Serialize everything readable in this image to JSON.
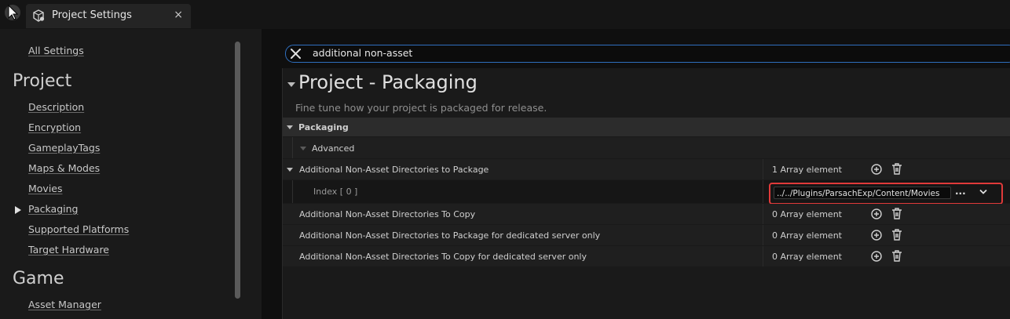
{
  "tab": {
    "title": "Project Settings",
    "close": "×"
  },
  "sidebar": {
    "all_settings": "All Settings",
    "project_heading": "Project",
    "project_items": [
      "Description",
      "Encryption",
      "GameplayTags",
      "Maps & Modes",
      "Movies",
      "Packaging",
      "Supported Platforms",
      "Target Hardware"
    ],
    "game_heading": "Game",
    "game_items": [
      "Asset Manager"
    ]
  },
  "search": {
    "value": "additional non-asset"
  },
  "section": {
    "title": "Project - Packaging",
    "description": "Fine tune how your project is packaged for release."
  },
  "rows": {
    "packaging": "Packaging",
    "advanced": "Advanced",
    "dirs_package": {
      "label": "Additional Non-Asset Directories to Package",
      "value": "1 Array element"
    },
    "index": {
      "label": "Index [ 0 ]",
      "value": "../../Plugins/ParsachExp/Content/Movies",
      "ellipsis": "..."
    },
    "dirs_copy": {
      "label": "Additional Non-Asset Directories To Copy",
      "value": "0 Array element"
    },
    "dirs_package_server": {
      "label": "Additional Non-Asset Directories to Package for dedicated server only",
      "value": "0 Array element"
    },
    "dirs_copy_server": {
      "label": "Additional Non-Asset Directories To Copy for dedicated server only",
      "value": "0 Array element"
    }
  },
  "colors": {
    "highlight": "#e03a3a",
    "search_border": "#2f6fbf"
  }
}
